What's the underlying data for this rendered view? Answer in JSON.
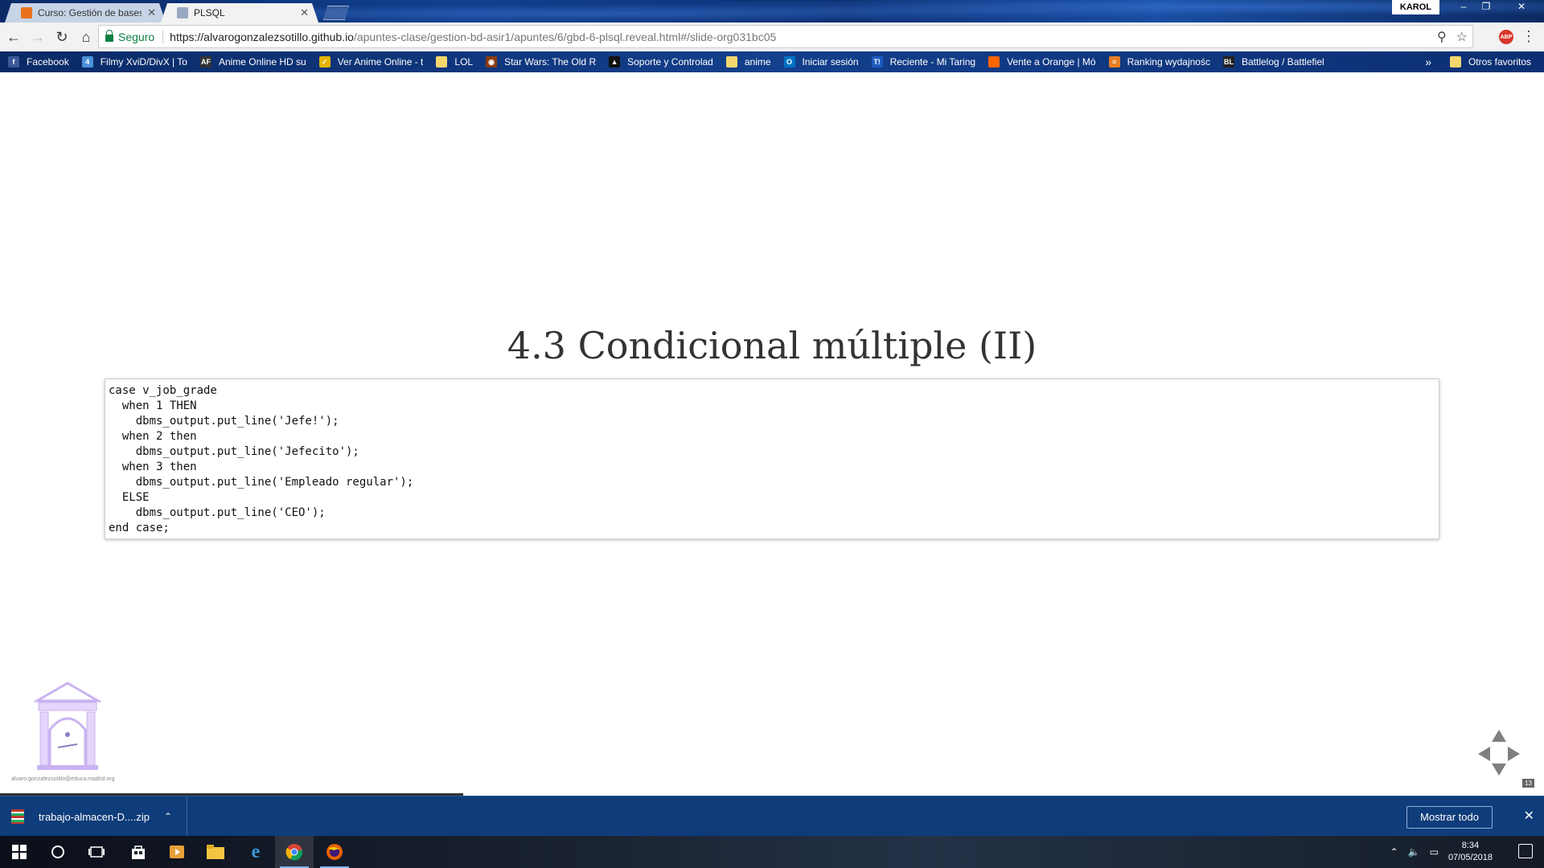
{
  "browser": {
    "tabs": [
      {
        "label": "Curso: Gestión de bases d",
        "favicon_color": "#e8731c",
        "active": false
      },
      {
        "label": "PLSQL",
        "favicon_color": "#9aa7c2",
        "active": true
      }
    ],
    "profile": "KAROL",
    "window_controls": {
      "minimize": "–",
      "restore": "❐",
      "close": "✕"
    }
  },
  "toolbar": {
    "secure_label": "Seguro",
    "url_host": "https://alvarogonzalezsotillo.github.io",
    "url_path": "/apuntes-clase/gestion-bd-asir1/apuntes/6/gbd-6-plsql.reveal.html#/slide-org031bc05",
    "extension_label": "ABP"
  },
  "bookmarks": [
    {
      "label": "Facebook",
      "icon": "f",
      "color": "#3b5998"
    },
    {
      "label": "Filmy XviD/DivX | To",
      "icon": "4",
      "color": "#4a90d9"
    },
    {
      "label": "Anime Online HD su",
      "icon": "AF",
      "color": "#333333"
    },
    {
      "label": "Ver Anime Online - t",
      "icon": "✓",
      "color": "#e2b400"
    },
    {
      "label": "LOL",
      "icon": "",
      "color": "#f5d76e"
    },
    {
      "label": "Star Wars: The Old R",
      "icon": "◉",
      "color": "#8a3b12"
    },
    {
      "label": "Soporte y Controlad",
      "icon": "▲",
      "color": "#111111"
    },
    {
      "label": "anime",
      "icon": "",
      "color": "#f5d76e"
    },
    {
      "label": "Iniciar sesión",
      "icon": "O",
      "color": "#0072c6"
    },
    {
      "label": "Reciente - Mi Taring",
      "icon": "T!",
      "color": "#1d5bbf"
    },
    {
      "label": "Vente a Orange | Mó",
      "icon": "",
      "color": "#ff6600"
    },
    {
      "label": "Ranking wydajnośc",
      "icon": "≡",
      "color": "#e67e22"
    },
    {
      "label": "Battlelog / Battlefiel",
      "icon": "BL",
      "color": "#222222"
    }
  ],
  "bookmarks_more": "»",
  "bookmarks_other": "Otros favoritos",
  "slide": {
    "title": "4.3 Condicional múltiple (II)",
    "code_lines": [
      "case v_job_grade",
      "  when 1 THEN",
      "    dbms_output.put_line('Jefe!');",
      "  when 2 then",
      "    dbms_output.put_line('Jefecito');",
      "  when 3 then",
      "    dbms_output.put_line('Empleado regular');",
      "  ELSE",
      "    dbms_output.put_line('CEO');",
      "end case;"
    ],
    "footer_email": "alvaro.gonzalezsotillo@educa.madrid.org",
    "slide_number": "13",
    "progress": 0.3
  },
  "downloads": {
    "file": "trabajo-almacen-D....zip",
    "show_all": "Mostrar todo"
  },
  "taskbar": {
    "time": "8:34",
    "date": "07/05/2018"
  }
}
